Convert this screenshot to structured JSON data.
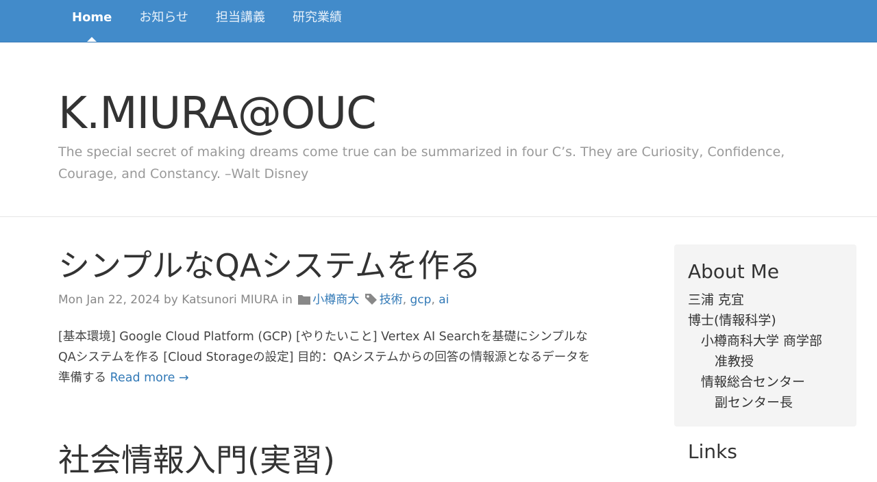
{
  "nav": {
    "items": [
      {
        "label": "Home",
        "active": true
      },
      {
        "label": "お知らせ"
      },
      {
        "label": "担当講義"
      },
      {
        "label": "研究業績"
      }
    ]
  },
  "site": {
    "title": "K.MIURA@OUC",
    "description": "The special secret of making dreams come true can be summarized in four C’s. They are Curiosity, Confidence, Courage, and Constancy. –Walt Disney"
  },
  "post": {
    "title": "シンプルなQAシステムを作る",
    "date": "Mon Jan 22, 2024",
    "by": "by",
    "author": "Katsunori MIURA",
    "in": "in",
    "category": "小樽商大",
    "tags": [
      "技術",
      "gcp",
      "ai"
    ],
    "excerpt": "[基本環境] Google Cloud Platform (GCP) [やりたいこと] Vertex AI Searchを基礎にシンプルなQAシステムを作る [Cloud Storageの設定] 目的：QAシステムからの回答の情報源となるデータを準備する",
    "read_more": "Read more →"
  },
  "next_post": {
    "title": "社会情報入門(実習)"
  },
  "sidebar": {
    "about_title": "About Me",
    "lines": [
      "三浦 克宜",
      "博士(情報科学)",
      "小樽商科大学 商学部",
      "准教授",
      "情報総合センター",
      "副センター長"
    ],
    "links_title": "Links"
  },
  "colors": {
    "navbar": "#428bca",
    "link": "#337ab7",
    "sidebar_bg": "#f4f4f4"
  },
  "icons": {
    "category": "folder-icon",
    "tags": "tag-icon"
  }
}
